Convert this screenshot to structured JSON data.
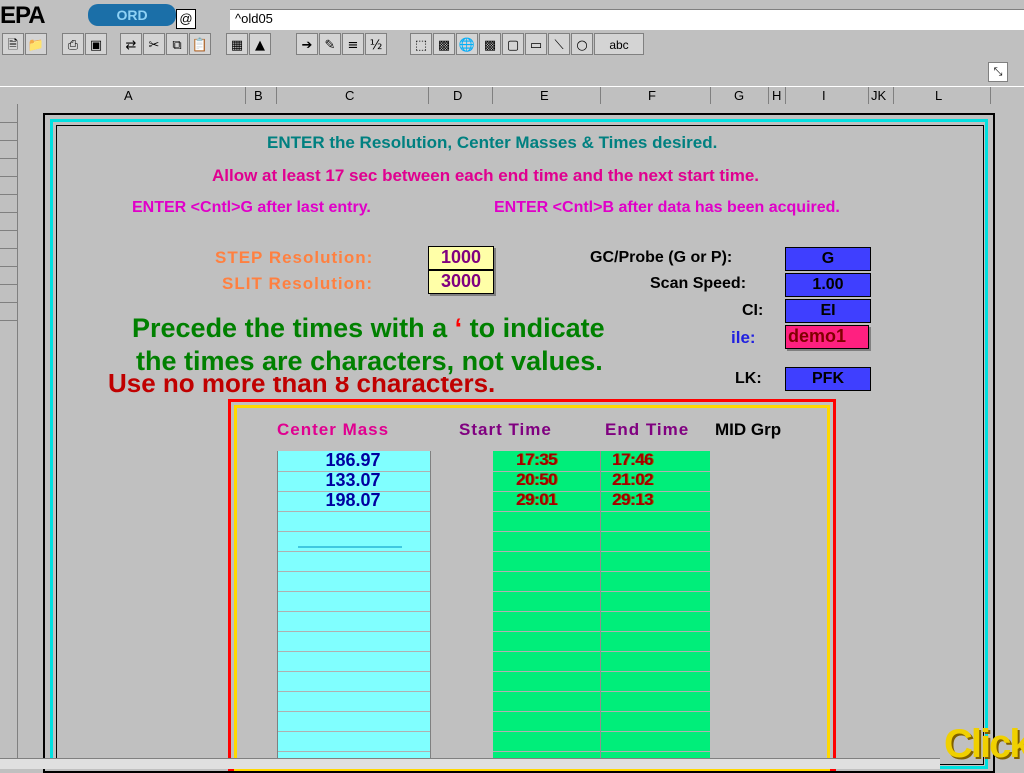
{
  "app": {
    "logo": "EPA",
    "badge": "ORD",
    "cell_ref": "@",
    "formula_value": "^old05"
  },
  "columns": [
    "A",
    "B",
    "C",
    "D",
    "E",
    "F",
    "G",
    "H",
    "I",
    "JK",
    "L"
  ],
  "instructions": {
    "line1": "ENTER the Resolution, Center Masses & Times desired.",
    "line2": "Allow at least 17 sec between each end time and the next start time.",
    "line3a": "ENTER <Cntl>G after last entry.",
    "line3b": "ENTER <Cntl>B after data has been acquired."
  },
  "resolution": {
    "step_label": "STEP Resolution:",
    "step_value": "1000",
    "slit_label": "SLIT Resolution:",
    "slit_value": "3000"
  },
  "settings": {
    "gc_label": "GC/Probe (G or P):",
    "gc_value": "G",
    "speed_label": "Scan Speed:",
    "speed_value": "1.00",
    "ci_label": "CI:",
    "ci_value": "EI",
    "file_label": "ile:",
    "file_value": "demo1",
    "lk_label": "LK:",
    "lk_value": "PFK"
  },
  "overlay": {
    "line1_a": "Precede the times with a ",
    "line1_mark": "‘",
    "line1_b": " to indicate",
    "line2": "the times are characters, not values.",
    "ghost": "Use no more than 8 characters."
  },
  "table": {
    "headers": {
      "mass": "Center Mass",
      "start": "Start Time",
      "end": "End Time",
      "mid": "MID Grp"
    },
    "rows": [
      {
        "mass": "186.97",
        "start": "17:35",
        "end": "17:46"
      },
      {
        "mass": "133.07",
        "start": "20:50",
        "end": "21:02"
      },
      {
        "mass": "198.07",
        "start": "29:01",
        "end": "29:13"
      }
    ]
  },
  "click_label": "Click",
  "colors": {
    "teal": "#008080",
    "magenta": "#e00090",
    "orange": "#ff8040",
    "green": "#008000",
    "cyan": "#80ffff",
    "mint": "#00ee7a"
  }
}
